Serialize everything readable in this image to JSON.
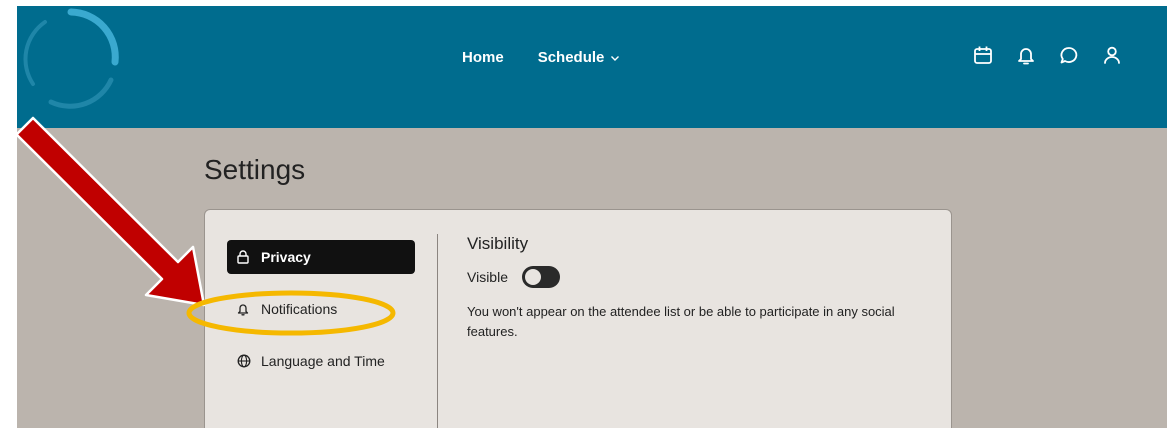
{
  "header": {
    "nav": [
      {
        "label": "Home"
      },
      {
        "label": "Schedule"
      }
    ],
    "icons": [
      "calendar-icon",
      "bell-icon",
      "chat-icon",
      "user-icon"
    ]
  },
  "page": {
    "title": "Settings"
  },
  "settings_menu": {
    "items": [
      {
        "label": "Privacy",
        "icon": "lock-icon",
        "active": true
      },
      {
        "label": "Notifications",
        "icon": "bell-icon",
        "active": false
      },
      {
        "label": "Language and Time",
        "icon": "globe-icon",
        "active": false
      }
    ]
  },
  "visibility": {
    "title": "Visibility",
    "toggle_label": "Visible",
    "toggle_on": false,
    "description": "You won't appear on the attendee list or be able to participate in any social features."
  },
  "colors": {
    "header": "#006c8e",
    "background": "#bbb4ad",
    "card": "#e8e4e0",
    "arrow": "#c00000",
    "highlight": "#f5b800"
  }
}
